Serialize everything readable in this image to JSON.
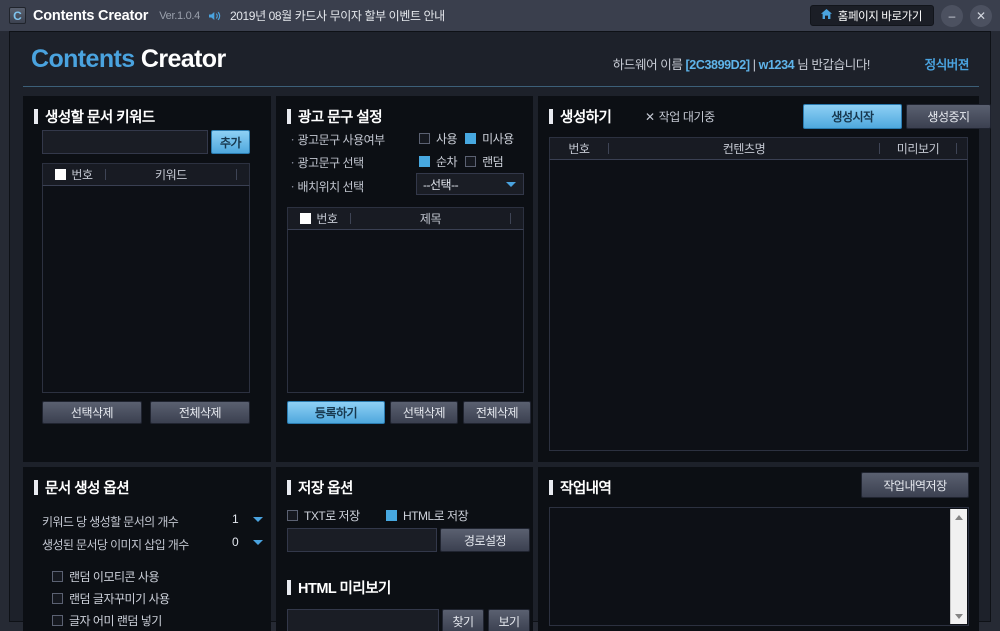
{
  "titlebar": {
    "app_icon": "app-logo-icon",
    "title": "Contents Creator",
    "version": "Ver.1.0.4",
    "speaker_icon": "speaker-icon",
    "notice": "2019년 08월 카드사 무이자 할부 이벤트 안내",
    "home_button": "홈페이지 바로가기",
    "home_icon": "home-icon",
    "minimize": "–",
    "close": "✕"
  },
  "header": {
    "brand_first": "Contents",
    "brand_second": "Creator",
    "hw_label": "하드웨어 이름",
    "hw_id": "[2C3899D2]",
    "separator": "|",
    "user": "w1234",
    "greeting": "님 반갑습니다!",
    "license": "정식버젼"
  },
  "keyword_panel": {
    "title": "생성할 문서 키워드",
    "input_value": "",
    "input_placeholder": "",
    "add_button": "추가",
    "columns": [
      "번호",
      "키워드"
    ],
    "rows": [],
    "delete_selected": "선택삭제",
    "delete_all": "전체삭제"
  },
  "adtext_panel": {
    "title": "광고 문구 설정",
    "use_label": "광고문구 사용여부",
    "use_option_on": "사용",
    "use_option_off": "미사용",
    "use_on_checked": false,
    "use_off_checked": true,
    "select_label": "광고문구 선택",
    "select_option_seq": "순차",
    "select_option_random": "랜덤",
    "seq_checked": true,
    "random_checked": false,
    "position_label": "배치위치 선택",
    "position_value": "--선택--",
    "columns": [
      "번호",
      "제목"
    ],
    "rows": [],
    "register_button": "등록하기",
    "delete_selected": "선택삭제",
    "delete_all": "전체삭제"
  },
  "generate_panel": {
    "title": "생성하기",
    "status_icon": "✕",
    "status_text": "작업 대기중",
    "start_button": "생성시작",
    "stop_button": "생성중지",
    "columns": [
      "번호",
      "컨텐츠명",
      "미리보기"
    ],
    "rows": []
  },
  "docopt_panel": {
    "title": "문서 생성 옵션",
    "docs_per_keyword_label": "키워드 당 생성할 문서의 개수",
    "docs_per_keyword_value": "1",
    "images_per_doc_label": "생성된 문서당 이미지 삽입 개수",
    "images_per_doc_value": "0",
    "checkboxes": [
      {
        "label": "랜덤 이모티콘 사용",
        "checked": false
      },
      {
        "label": "랜덤 글자꾸미기 사용",
        "checked": false
      },
      {
        "label": "글자 어미 랜덤 넣기",
        "checked": false
      }
    ]
  },
  "saveopt_panel": {
    "title": "저장 옵션",
    "txt_label": "TXT로 저장",
    "txt_checked": false,
    "html_label": "HTML로 저장",
    "html_checked": true,
    "path_value": "",
    "path_button": "경로설정",
    "preview_title": "HTML 미리보기",
    "preview_path_value": "",
    "find_button": "찾기",
    "view_button": "보기"
  },
  "worklog_panel": {
    "title": "작업내역",
    "save_button": "작업내역저장",
    "log_text": "",
    "scroll_up_icon": "triangle-up-icon",
    "scroll_down_icon": "triangle-down-icon"
  },
  "colors": {
    "accent": "#4aa3df",
    "titlebar": "#3a3f4d",
    "panel_bg": "#0c0f14",
    "frame_bg": "#1d212a"
  }
}
